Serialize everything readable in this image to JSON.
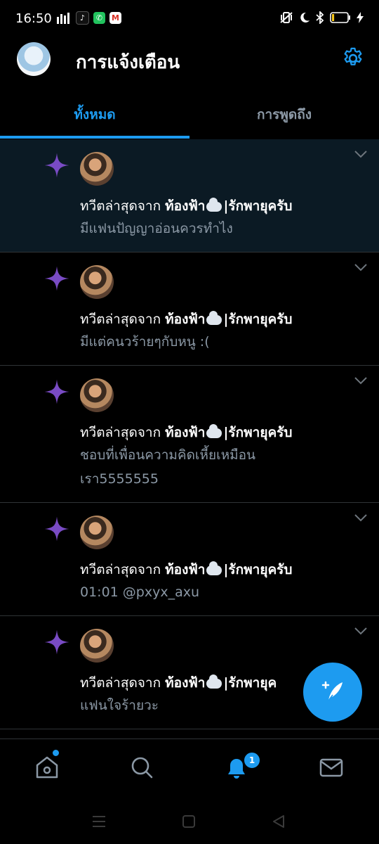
{
  "status_bar": {
    "time": "16:50",
    "notification_icons": [
      "signal-meter-icon",
      "tiktok-icon",
      "line-icon",
      "gmail-icon"
    ],
    "system_icons": [
      "vibrate-icon",
      "do-not-disturb-icon",
      "bluetooth-icon",
      "battery-icon",
      "charging-icon"
    ],
    "battery_level": 0.15
  },
  "header": {
    "title": "การแจ้งเตือน",
    "settings_icon": "gear-icon"
  },
  "tabs": [
    {
      "label": "ทั้งหมด",
      "active": true
    },
    {
      "label": "การพูดถึง",
      "active": false
    }
  ],
  "notifications": [
    {
      "prefix": "ทวีตล่าสุดจาก",
      "author": "ท้องฟ้า",
      "author_suffix": "|รักพายุครับ",
      "text": "มีแฟนปัญญาอ่อนควรทำไง",
      "unread": true
    },
    {
      "prefix": "ทวีตล่าสุดจาก",
      "author": "ท้องฟ้า",
      "author_suffix": "|รักพายุครับ",
      "text": "มีแต่คนวร้ายๆกับหนู :(",
      "unread": false
    },
    {
      "prefix": "ทวีตล่าสุดจาก",
      "author": "ท้องฟ้า",
      "author_suffix": "|รักพายุครับ",
      "text": "ชอบที่เพื่อนความคิดเหี้ยเหมือนเรา5555555",
      "unread": false
    },
    {
      "prefix": "ทวีตล่าสุดจาก",
      "author": "ท้องฟ้า",
      "author_suffix": "|รักพายุครับ",
      "text": "01:01 @pxyx_axu",
      "unread": false
    },
    {
      "prefix": "ทวีตล่าสุดจาก",
      "author": "ท้องฟ้า",
      "author_suffix": "|รักพายุค",
      "text": "แฟนใจร้ายวะ",
      "unread": false
    }
  ],
  "fab": {
    "icon": "compose-tweet-icon"
  },
  "bottom_nav": {
    "items": [
      "home-icon",
      "search-icon",
      "notifications-icon",
      "messages-icon"
    ],
    "notification_badge": "1"
  },
  "system_nav": [
    "recents-icon",
    "home-button-icon",
    "back-icon"
  ],
  "colors": {
    "accent": "#1d9bf0",
    "spark": "#794bc4",
    "muted": "#8b98a5",
    "background": "#000000",
    "unread_bg": "#0b1a24"
  }
}
